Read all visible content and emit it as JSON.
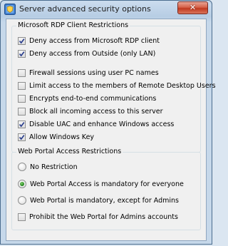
{
  "window": {
    "title": "Server advanced security options",
    "close_symbol": "✕",
    "icon": "security-app-icon"
  },
  "rdp_group": {
    "title": "Microsoft RDP Client Restrictions",
    "items": [
      {
        "label": "Deny access from Microsoft RDP client",
        "checked": true
      },
      {
        "label": "Deny access from Outside (only LAN)",
        "checked": true
      },
      {
        "label": "Firewall sessions using user PC names",
        "checked": false
      },
      {
        "label": "Limit access to the members of Remote Desktop Users",
        "checked": false
      },
      {
        "label": "Encrypts end-to-end communications",
        "checked": false
      },
      {
        "label": "Block all incoming access to this server",
        "checked": false
      },
      {
        "label": "Disable UAC and enhance Windows access",
        "checked": true
      },
      {
        "label": "Allow Windows Key",
        "checked": true
      }
    ]
  },
  "portal_group": {
    "title": "Web Portal Access Restrictions",
    "radios": [
      {
        "label": "No Restriction",
        "selected": false
      },
      {
        "label": "Web Portal Access is mandatory for everyone",
        "selected": true
      },
      {
        "label": "Web Portal is mandatory, except for Admins",
        "selected": false
      }
    ],
    "checkbox": {
      "label": "Prohibit the Web Portal for Admins accounts",
      "checked": false
    }
  }
}
